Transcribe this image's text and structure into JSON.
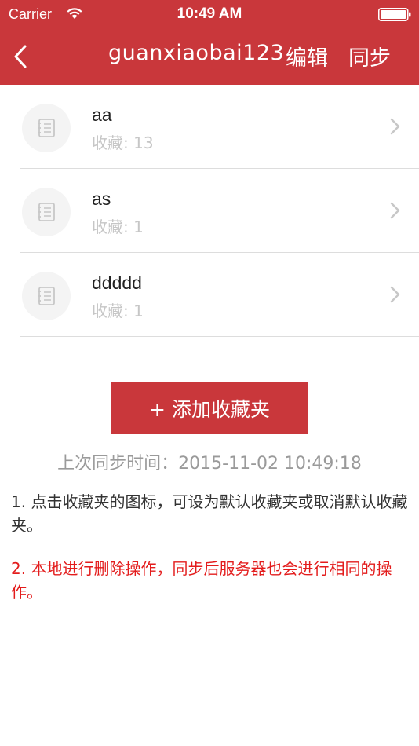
{
  "status_bar": {
    "carrier": "Carrier",
    "time": "10:49 AM"
  },
  "nav": {
    "title": "guanxiaobai123",
    "edit_label": "编辑",
    "sync_label": "同步",
    "color": "#c9373b"
  },
  "folders": [
    {
      "name": "aa",
      "count": "收藏: 13"
    },
    {
      "name": "as",
      "count": "收藏: 1"
    },
    {
      "name": "ddddd",
      "count": "收藏: 1"
    }
  ],
  "add_button_label": "+ 添加收藏夹",
  "last_sync": "上次同步时间：2015-11-02 10:49:18",
  "notes": [
    "1. 点击收藏夹的图标，可设为默认收藏夹或取消默认收藏夹。",
    "2. 本地进行删除操作，同步后服务器也会进行相同的操作。"
  ],
  "icons": {
    "back": "chevron-left-icon",
    "folder": "notebook-icon",
    "row": "chevron-right-icon"
  }
}
